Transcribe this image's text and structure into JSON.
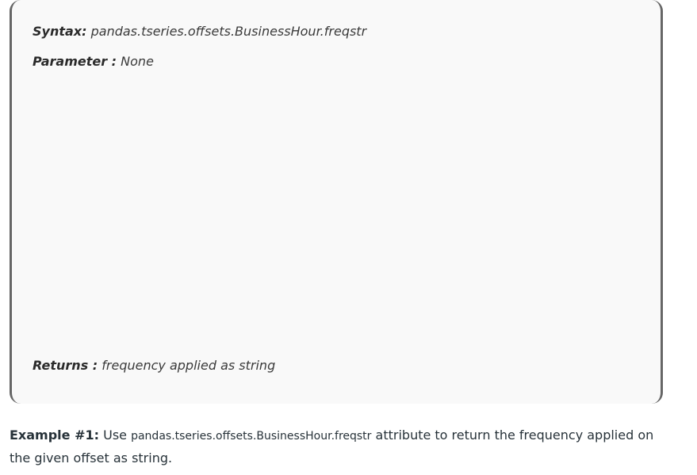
{
  "syntax_box": {
    "syntax_label": "Syntax:",
    "syntax_value": "pandas.tseries.offsets.BusinessHour.freqstr",
    "parameter_label": "Parameter :",
    "parameter_value": "None",
    "returns_label": "Returns :",
    "returns_value": "frequency applied as string"
  },
  "example": {
    "label": "Example #1:",
    "text_before": "Use",
    "code": "pandas.tseries.offsets.BusinessHour.freqstr",
    "text_after": "attribute to return the frequency applied on the given offset as string."
  }
}
